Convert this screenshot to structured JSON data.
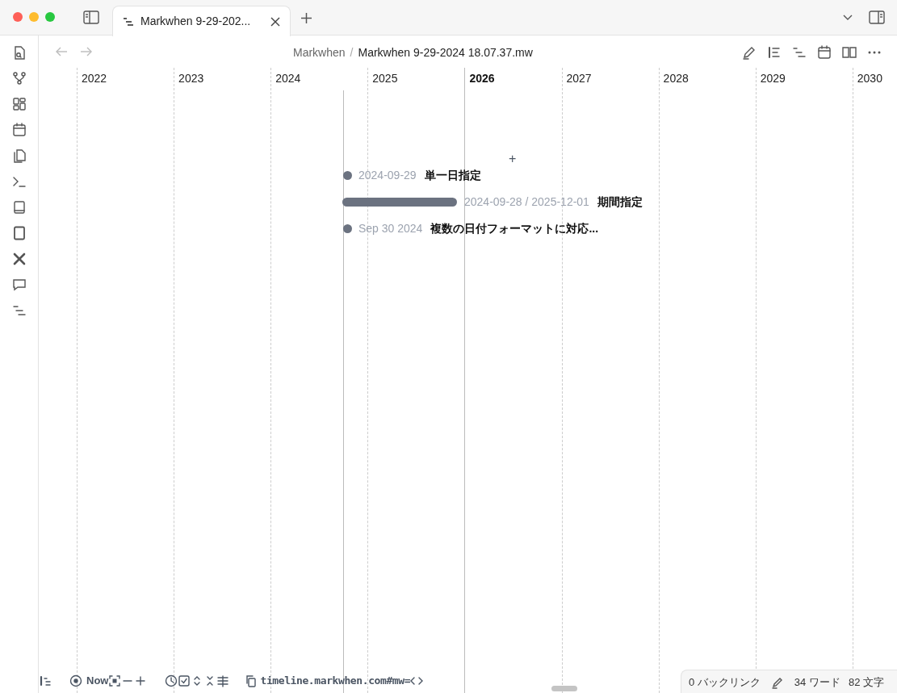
{
  "tab": {
    "title": "Markwhen 9-29-202...",
    "selected": true
  },
  "breadcrumb": {
    "parent": "Markwhen",
    "separator": "/",
    "current": "Markwhen 9-29-2024 18.07.37.mw"
  },
  "years": [
    {
      "label": "2022",
      "current": false
    },
    {
      "label": "2023",
      "current": false
    },
    {
      "label": "2024",
      "current": false
    },
    {
      "label": "2025",
      "current": false
    },
    {
      "label": "2026",
      "current": true
    },
    {
      "label": "2027",
      "current": false
    },
    {
      "label": "2028",
      "current": false
    },
    {
      "label": "2029",
      "current": false
    },
    {
      "label": "2030",
      "current": false
    }
  ],
  "add_label": "+",
  "events": [
    {
      "kind": "point",
      "date": "2024-09-29",
      "title": "単一日指定"
    },
    {
      "kind": "range",
      "date": "2024-09-28 / 2025-12-01",
      "title": "期間指定"
    },
    {
      "kind": "point",
      "date": "Sep 30 2024",
      "title": "複数の日付フォーマットに対応..."
    }
  ],
  "toolbar": {
    "now_label": "Now",
    "share_url": "timeline.markwhen.com#mw="
  },
  "status_bar": {
    "backlinks": "0 バックリンク",
    "words": "34 ワード",
    "chars": "82 文字"
  }
}
